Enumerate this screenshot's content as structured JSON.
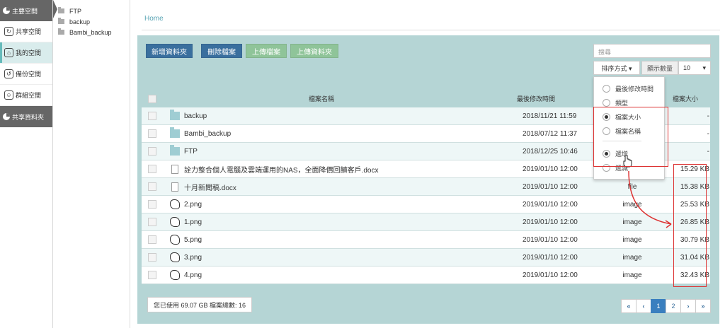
{
  "sidebar": {
    "items": [
      {
        "label": "主要空間",
        "icon": "pie-chart-icon",
        "style": "dark"
      },
      {
        "label": "共享空間",
        "icon": "share-icon",
        "style": "light"
      },
      {
        "label": "我的空間",
        "icon": "home-icon",
        "style": "selected"
      },
      {
        "label": "備份空間",
        "icon": "history-icon",
        "style": "light"
      },
      {
        "label": "群組空間",
        "icon": "group-icon",
        "style": "light"
      },
      {
        "label": "共享資料夾",
        "icon": "pie-chart-icon",
        "style": "dark"
      }
    ]
  },
  "tree": {
    "items": [
      "FTP",
      "backup",
      "Bambi_backup"
    ]
  },
  "breadcrumb": {
    "home": "Home"
  },
  "toolbar": {
    "new_folder": "新增資料夾",
    "delete_file": "刪除檔案",
    "upload_file": "上傳檔案",
    "upload_folder": "上傳資料夾",
    "search_placeholder": "搜尋",
    "sort_label": "排序方式 ▾",
    "count_label": "顯示數量",
    "count_value": "10"
  },
  "table": {
    "headers": {
      "name": "檔案名稱",
      "modified": "最後修改時間",
      "size": "檔案大小"
    },
    "rows": [
      {
        "name": "backup",
        "modified": "2018/11/21 11:59",
        "type": "",
        "size": "-",
        "icon": "folder-icon"
      },
      {
        "name": "Bambi_backup",
        "modified": "2018/07/12 11:37",
        "type": "",
        "size": "-",
        "icon": "folder-icon"
      },
      {
        "name": "FTP",
        "modified": "2018/12/25 10:46",
        "type": "",
        "size": "-",
        "icon": "folder-icon"
      },
      {
        "name": "詮力整合個人電腦及雲端運用的NAS，全面降價回饋客戶.docx",
        "modified": "2019/01/10 12:00",
        "type": "",
        "size": "15.29 KB",
        "icon": "document-icon"
      },
      {
        "name": "十月新聞稿.docx",
        "modified": "2019/01/10 12:00",
        "type": "file",
        "size": "15.38 KB",
        "icon": "document-icon"
      },
      {
        "name": "2.png",
        "modified": "2019/01/10 12:00",
        "type": "image",
        "size": "25.53 KB",
        "icon": "image-thumbnail-icon"
      },
      {
        "name": "1.png",
        "modified": "2019/01/10 12:00",
        "type": "image",
        "size": "26.85 KB",
        "icon": "image-thumbnail-icon"
      },
      {
        "name": "5.png",
        "modified": "2019/01/10 12:00",
        "type": "image",
        "size": "30.79 KB",
        "icon": "image-thumbnail-icon"
      },
      {
        "name": "3.png",
        "modified": "2019/01/10 12:00",
        "type": "image",
        "size": "31.04 KB",
        "icon": "image-thumbnail-icon"
      },
      {
        "name": "4.png",
        "modified": "2019/01/10 12:00",
        "type": "image",
        "size": "32.43 KB",
        "icon": "image-thumbnail-icon"
      }
    ]
  },
  "sort_menu": {
    "options": [
      "最後修改時間",
      "類型",
      "檔案大小",
      "檔案名稱"
    ],
    "order_options": [
      "遞增",
      "遞減"
    ],
    "selected_option": "檔案大小",
    "selected_order": "遞增"
  },
  "footer": {
    "usage": "您已使用  69.07 GB  檔案總數: 16",
    "pages": [
      "«",
      "‹",
      "1",
      "2",
      "›",
      "»"
    ],
    "current_page": "1"
  },
  "colors": {
    "primary_button": "#3a6f9e",
    "upload_button": "#8fc499",
    "panel_background": "#b5d5d5",
    "highlight": "#dd3333"
  }
}
